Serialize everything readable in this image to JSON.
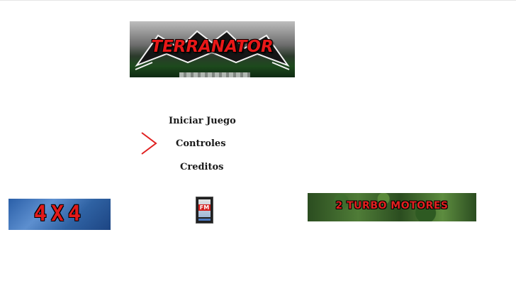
{
  "title": {
    "logo_text": "TERRANATOR"
  },
  "menu": {
    "items": [
      "Iniciar Juego",
      "Controles",
      "Creditos"
    ],
    "selected": "Controles",
    "cursor_color": "#e02020"
  },
  "badges": {
    "four_by_four": "4X4",
    "radio": "FM",
    "turbo": "2 TURBO MOTORES"
  },
  "colors": {
    "accent_red": "#e81818",
    "background": "#ffffff"
  }
}
